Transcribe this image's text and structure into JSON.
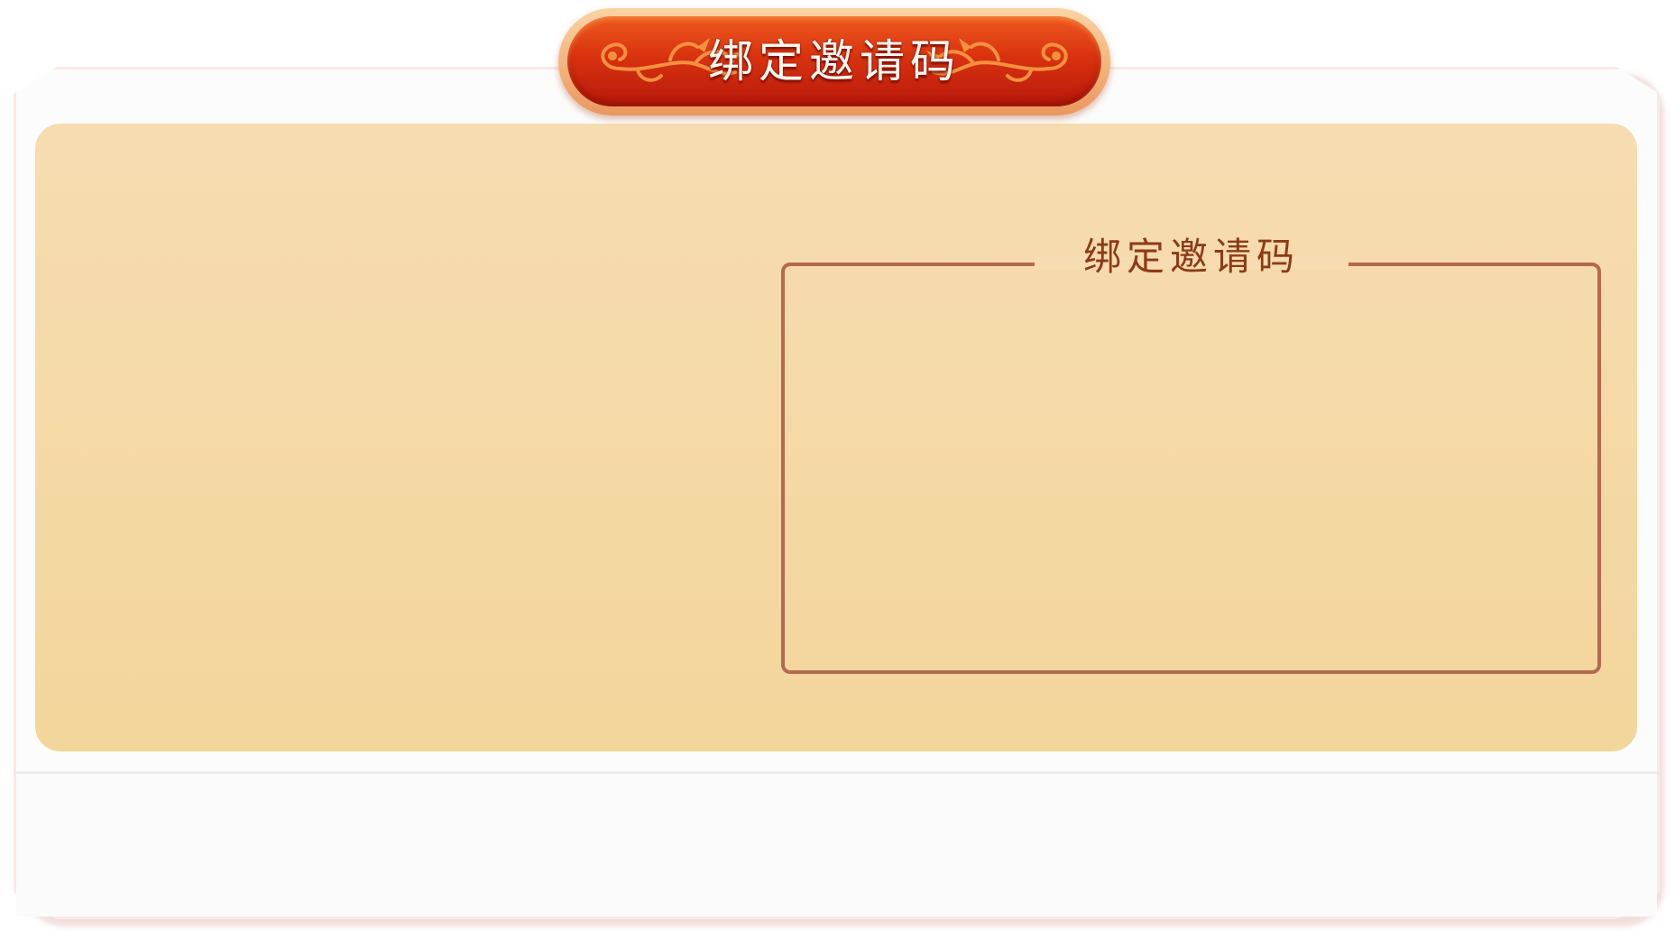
{
  "dialog": {
    "title": "绑定邀请码"
  },
  "invite_code_section": {
    "label": "绑定邀请码"
  },
  "colors": {
    "badge_red": "#d8320f",
    "badge_border": "#f3b37a",
    "panel_cream": "#f5d9a8",
    "box_border": "#b46a4e",
    "section_label": "#8d3a18"
  },
  "icons": {
    "title_ornament": "floral-scroll-icon"
  }
}
